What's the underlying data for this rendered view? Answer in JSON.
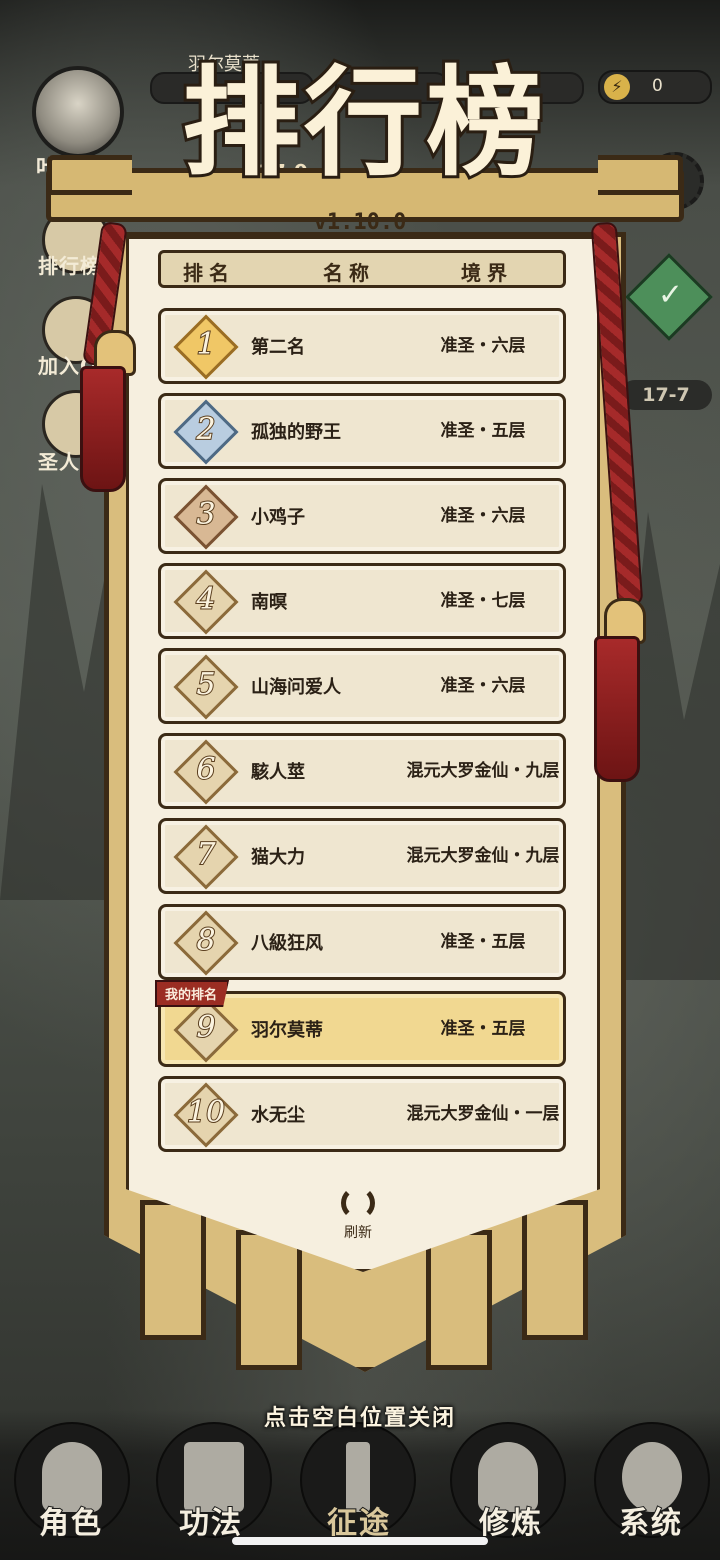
{
  "hud": {
    "player_name": "叶凡",
    "top_name": "羽尔莫蒂",
    "energy_value": "0",
    "level_left": "17-9",
    "stage_right": "17-7"
  },
  "sidebar": {
    "items": [
      {
        "label": "排行榜"
      },
      {
        "label": "加入Q"
      },
      {
        "label": "圣人"
      }
    ]
  },
  "leaderboard": {
    "title": "排行榜",
    "version": "v1.10.0",
    "columns": [
      "排名",
      "名称",
      "境界"
    ],
    "my_rank_tag": "我的排名",
    "rows": [
      {
        "rank": "1",
        "name": "第二名",
        "realm": "准圣・六层",
        "tier": "gold"
      },
      {
        "rank": "2",
        "name": "孤独的野王",
        "realm": "准圣・五层",
        "tier": "silver"
      },
      {
        "rank": "3",
        "name": "小鸡子",
        "realm": "准圣・六层",
        "tier": "bronze"
      },
      {
        "rank": "4",
        "name": "南暝",
        "realm": "准圣・七层",
        "tier": "plain"
      },
      {
        "rank": "5",
        "name": "山海问爱人",
        "realm": "准圣・六层",
        "tier": "plain"
      },
      {
        "rank": "6",
        "name": "駭人莖",
        "realm": "混元大罗金仙・九层",
        "tier": "plain"
      },
      {
        "rank": "7",
        "name": "猫大力",
        "realm": "混元大罗金仙・九层",
        "tier": "plain"
      },
      {
        "rank": "8",
        "name": "八級狂风",
        "realm": "准圣・五层",
        "tier": "plain"
      },
      {
        "rank": "9",
        "name": "羽尔莫蒂",
        "realm": "准圣・五层",
        "tier": "me"
      },
      {
        "rank": "10",
        "name": "水无尘",
        "realm": "混元大罗金仙・一层",
        "tier": "plain"
      }
    ],
    "refresh_label": "刷新",
    "close_hint": "点击空白位置关闭"
  },
  "bottom_nav": {
    "items": [
      {
        "label": "角色"
      },
      {
        "label": "功法"
      },
      {
        "label": "征途",
        "active": true
      },
      {
        "label": "修炼"
      },
      {
        "label": "系统"
      }
    ]
  },
  "colors": {
    "banner": "#d9bd7d",
    "panel": "#f6efdf",
    "outline": "#3b2a16",
    "my_row": "#f1d891",
    "tassel": "#a52a2a"
  }
}
